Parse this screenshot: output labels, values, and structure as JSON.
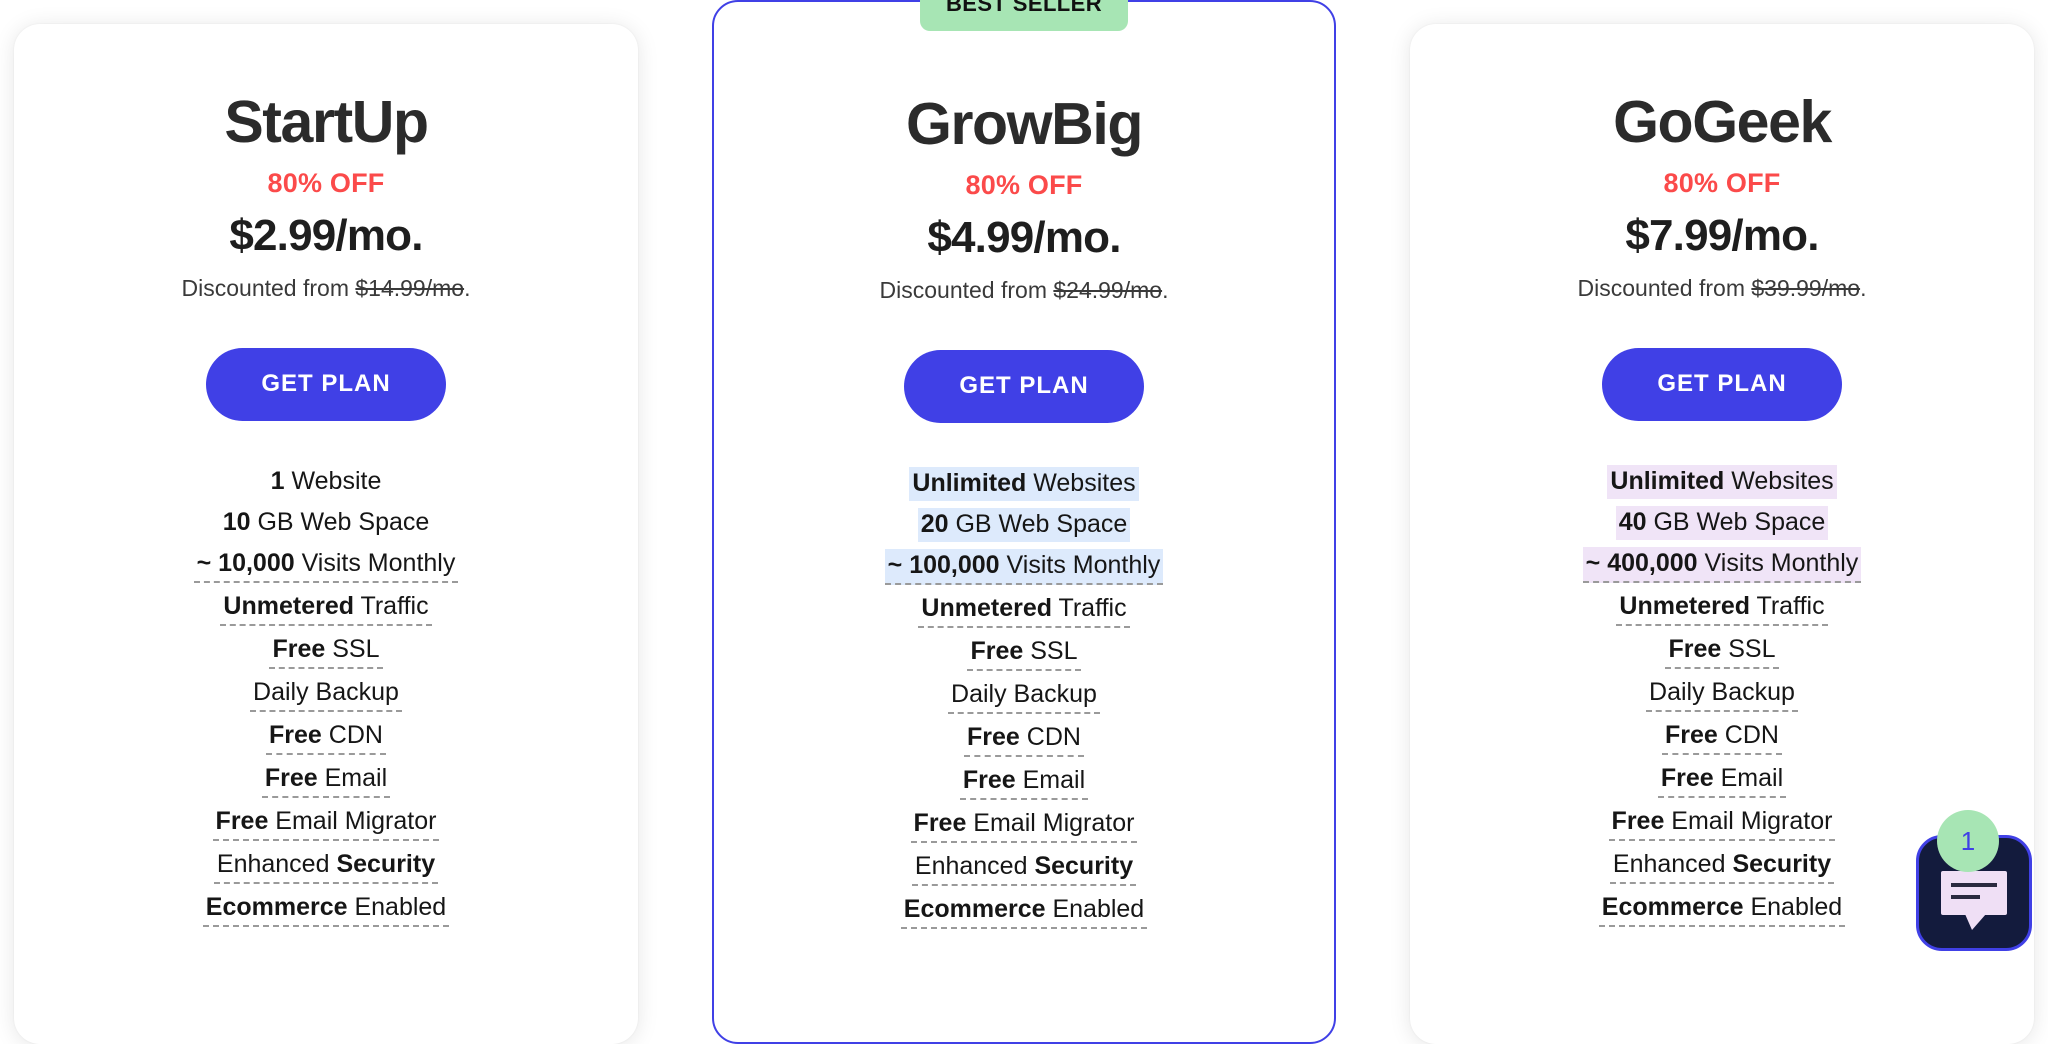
{
  "colors": {
    "accent": "#4040e6",
    "discount_red": "#fb4a4a",
    "badge_green": "#a7e5b4",
    "highlight_blue": "#ddeafc",
    "highlight_purple": "#f0e4f7",
    "chat_navy": "#131b3d"
  },
  "plans": [
    {
      "name": "StartUp",
      "discount": "80% OFF",
      "price": "$2.99/mo.",
      "discounted_from_label": "Discounted from ",
      "old_price": "$14.99/mo",
      "trailing_period": ".",
      "cta": "GET PLAN",
      "badge": null,
      "highlight": "none",
      "features": [
        {
          "bold": "1",
          "rest": " Website",
          "bold_first": true,
          "dots": false,
          "highlight": false
        },
        {
          "bold": "10",
          "rest": " GB Web Space",
          "bold_first": true,
          "dots": false,
          "highlight": false
        },
        {
          "bold": "~ 10,000",
          "rest": " Visits Monthly",
          "bold_first": true,
          "dots": true,
          "highlight": false
        },
        {
          "bold": "Unmetered",
          "rest": " Traffic",
          "bold_first": true,
          "dots": true,
          "highlight": false
        },
        {
          "bold": "Free",
          "rest": " SSL",
          "bold_first": true,
          "dots": true,
          "highlight": false
        },
        {
          "bold": "",
          "rest": "Daily Backup",
          "bold_first": true,
          "dots": true,
          "highlight": false
        },
        {
          "bold": "Free",
          "rest": " CDN",
          "bold_first": true,
          "dots": true,
          "highlight": false
        },
        {
          "bold": "Free",
          "rest": " Email",
          "bold_first": true,
          "dots": true,
          "highlight": false
        },
        {
          "bold": "Free",
          "rest": " Email Migrator",
          "bold_first": true,
          "dots": true,
          "highlight": false
        },
        {
          "bold": "Security",
          "rest": "Enhanced ",
          "bold_first": false,
          "dots": true,
          "highlight": false
        },
        {
          "bold": "Ecommerce",
          "rest": " Enabled",
          "bold_first": true,
          "dots": true,
          "highlight": false
        }
      ]
    },
    {
      "name": "GrowBig",
      "discount": "80% OFF",
      "price": "$4.99/mo.",
      "discounted_from_label": "Discounted from ",
      "old_price": "$24.99/mo",
      "trailing_period": ".",
      "cta": "GET PLAN",
      "badge": "BEST SELLER",
      "highlight": "blue",
      "features": [
        {
          "bold": "Unlimited",
          "rest": " Websites",
          "bold_first": true,
          "dots": false,
          "highlight": true
        },
        {
          "bold": "20",
          "rest": " GB Web Space",
          "bold_first": true,
          "dots": false,
          "highlight": true
        },
        {
          "bold": "~ 100,000",
          "rest": " Visits Monthly",
          "bold_first": true,
          "dots": true,
          "highlight": true
        },
        {
          "bold": "Unmetered",
          "rest": " Traffic",
          "bold_first": true,
          "dots": true,
          "highlight": false
        },
        {
          "bold": "Free",
          "rest": " SSL",
          "bold_first": true,
          "dots": true,
          "highlight": false
        },
        {
          "bold": "",
          "rest": "Daily Backup",
          "bold_first": true,
          "dots": true,
          "highlight": false
        },
        {
          "bold": "Free",
          "rest": " CDN",
          "bold_first": true,
          "dots": true,
          "highlight": false
        },
        {
          "bold": "Free",
          "rest": " Email",
          "bold_first": true,
          "dots": true,
          "highlight": false
        },
        {
          "bold": "Free",
          "rest": " Email Migrator",
          "bold_first": true,
          "dots": true,
          "highlight": false
        },
        {
          "bold": "Security",
          "rest": "Enhanced ",
          "bold_first": false,
          "dots": true,
          "highlight": false
        },
        {
          "bold": "Ecommerce",
          "rest": " Enabled",
          "bold_first": true,
          "dots": true,
          "highlight": false
        }
      ]
    },
    {
      "name": "GoGeek",
      "discount": "80% OFF",
      "price": "$7.99/mo.",
      "discounted_from_label": "Discounted from ",
      "old_price": "$39.99/mo",
      "trailing_period": ".",
      "cta": "GET PLAN",
      "badge": null,
      "highlight": "purple",
      "features": [
        {
          "bold": "Unlimited",
          "rest": " Websites",
          "bold_first": true,
          "dots": false,
          "highlight": true
        },
        {
          "bold": "40",
          "rest": " GB Web Space",
          "bold_first": true,
          "dots": false,
          "highlight": true
        },
        {
          "bold": "~ 400,000",
          "rest": " Visits Monthly",
          "bold_first": true,
          "dots": true,
          "highlight": true
        },
        {
          "bold": "Unmetered",
          "rest": " Traffic",
          "bold_first": true,
          "dots": true,
          "highlight": false
        },
        {
          "bold": "Free",
          "rest": " SSL",
          "bold_first": true,
          "dots": true,
          "highlight": false
        },
        {
          "bold": "",
          "rest": "Daily Backup",
          "bold_first": true,
          "dots": true,
          "highlight": false
        },
        {
          "bold": "Free",
          "rest": " CDN",
          "bold_first": true,
          "dots": true,
          "highlight": false
        },
        {
          "bold": "Free",
          "rest": " Email",
          "bold_first": true,
          "dots": true,
          "highlight": false
        },
        {
          "bold": "Free",
          "rest": " Email Migrator",
          "bold_first": true,
          "dots": true,
          "highlight": false
        },
        {
          "bold": "Security",
          "rest": "Enhanced ",
          "bold_first": false,
          "dots": true,
          "highlight": false
        },
        {
          "bold": "Ecommerce",
          "rest": " Enabled",
          "bold_first": true,
          "dots": true,
          "highlight": false
        }
      ]
    }
  ],
  "chat_widget": {
    "unread_count": "1",
    "icon": "chat-bubble-icon"
  }
}
